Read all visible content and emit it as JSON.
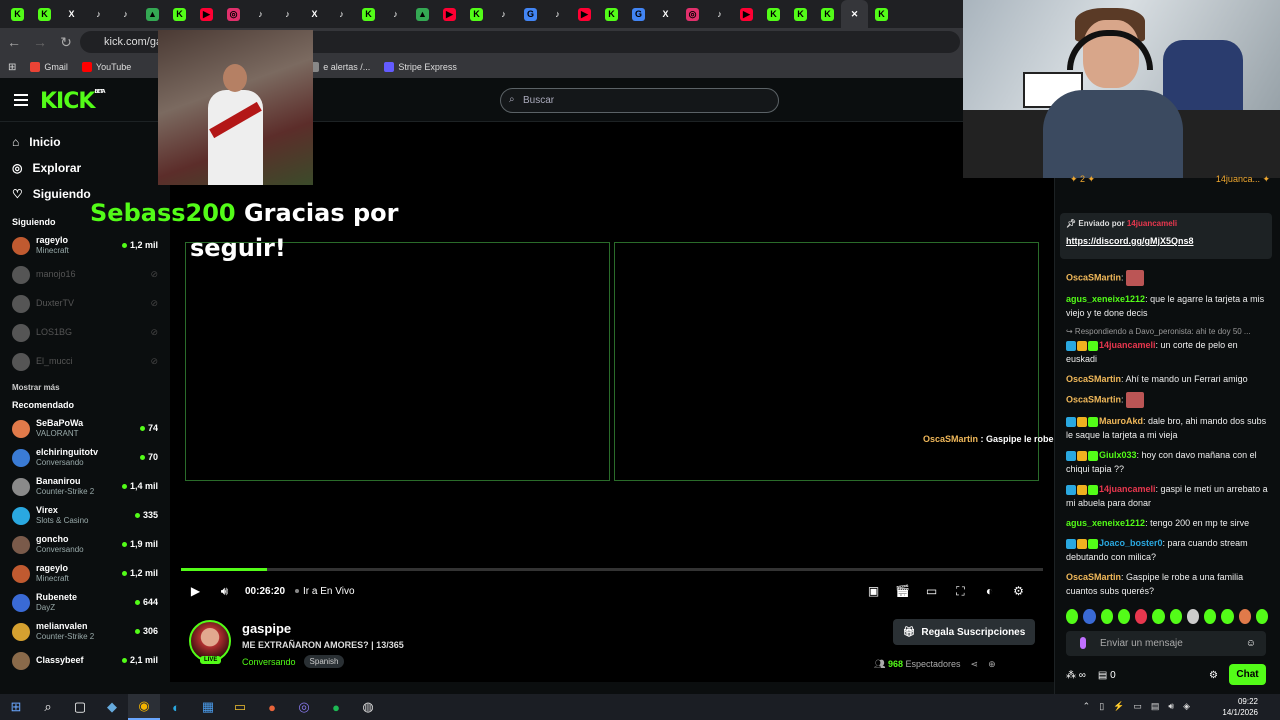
{
  "browser": {
    "tab_icons": [
      "K",
      "K",
      "X",
      "♪",
      "♪",
      "▲",
      "K",
      "▶",
      "◎",
      "♪",
      "♪",
      "X",
      "♪",
      "K",
      "♪",
      "▲",
      "▶",
      "K",
      "♪",
      "G",
      "♪",
      "▶",
      "K",
      "G",
      "X",
      "◎",
      "♪",
      "▶",
      "K",
      "K",
      "K",
      "✕",
      "K"
    ],
    "url": "kick.com/gas",
    "bookmarks": [
      {
        "label": "Gmail",
        "color": "#ea4335"
      },
      {
        "label": "YouTube",
        "color": "#ff0000"
      },
      {
        "label": "e alertas /...",
        "color": "#888888"
      },
      {
        "label": "Stripe Express",
        "color": "#635bff"
      }
    ]
  },
  "header": {
    "logo": "KICK",
    "logo_badge": "BETA",
    "search_placeholder": "Buscar"
  },
  "sidebar": {
    "nav": [
      {
        "label": "Inicio",
        "icon": "home-icon",
        "glyph": "⌂"
      },
      {
        "label": "Explorar",
        "icon": "compass-icon",
        "glyph": "◎"
      },
      {
        "label": "Siguiendo",
        "icon": "heart-icon",
        "glyph": "♡"
      }
    ],
    "following_title": "Siguiendo",
    "following": [
      {
        "name": "rageylo",
        "category": "Minecraft",
        "viewers": "1,2 mil",
        "live": true,
        "color": "#c05a30"
      },
      {
        "name": "manojo16",
        "category": "",
        "viewers": "",
        "live": false,
        "color": "#555"
      },
      {
        "name": "DuxterTV",
        "category": "",
        "viewers": "",
        "live": false,
        "color": "#555"
      },
      {
        "name": "LOS1BG",
        "category": "",
        "viewers": "",
        "live": false,
        "color": "#555"
      },
      {
        "name": "El_mucci",
        "category": "",
        "viewers": "",
        "live": false,
        "color": "#555"
      }
    ],
    "show_more": "Mostrar más",
    "recommended_title": "Recomendado",
    "recommended": [
      {
        "name": "SeBaPoWa",
        "category": "VALORANT",
        "viewers": "74",
        "color": "#e07a4a"
      },
      {
        "name": "elchiringuitotv",
        "category": "Conversando",
        "viewers": "70",
        "color": "#3a7bd5"
      },
      {
        "name": "Bananirou",
        "category": "Counter-Strike 2",
        "viewers": "1,4 mil",
        "color": "#8a8a8a"
      },
      {
        "name": "Virex",
        "category": "Slots & Casino",
        "viewers": "335",
        "color": "#2aa8e0"
      },
      {
        "name": "goncho",
        "category": "Conversando",
        "viewers": "1,9 mil",
        "color": "#7a5a4a"
      },
      {
        "name": "rageylo",
        "category": "Minecraft",
        "viewers": "1,2 mil",
        "color": "#c05a30"
      },
      {
        "name": "Rubenete",
        "category": "DayZ",
        "viewers": "644",
        "color": "#3a6ad5"
      },
      {
        "name": "melianvalen",
        "category": "Counter-Strike 2",
        "viewers": "306",
        "color": "#d5a030"
      },
      {
        "name": "Classybeef",
        "category": "",
        "viewers": "2,1 mil",
        "color": "#8a6a4a"
      }
    ]
  },
  "stream": {
    "alert_name": "Sebass200",
    "alert_text": " Gracias por",
    "alert_text2": "seguir!",
    "overlay_user": "OscaSMartin",
    "overlay_text": " : Gaspipe le robe a una familia cuantos subs querés?",
    "progress_fraction": 0.1,
    "time": "00:26:20",
    "go_live": "Ir a En Vivo"
  },
  "streamer": {
    "name": "gaspipe",
    "live_badge": "LIVE",
    "title": "ME EXTRAÑARON AMORES? | 13/365",
    "category": "Conversando",
    "tag": "Spanish",
    "gift_button": "Regala Suscripciones",
    "viewers": "968",
    "viewers_label": "Espectadores"
  },
  "chat": {
    "preview_left": "✦ 2 ✦",
    "preview_right": "14juanca... ✦",
    "pinned_by_label": "Enviado por",
    "pinned_user": "14juancameli",
    "pinned_link": "https://discord.gg/gMjX5Qns8",
    "messages": [
      {
        "user": "OscaSMartin",
        "color": "#f0b85a",
        "text": "",
        "emote": true
      },
      {
        "user": "agus_xeneixe1212",
        "color": "#53fc18",
        "text": ": que le agarre la tarjeta a mis viejo y te done decis"
      },
      {
        "reply": "↪ Respondiendo a Davo_peronista: ahi te doy 50 ...",
        "user": "14juancameli",
        "color": "#e8374e",
        "text": ": un corte de pelo en euskadi",
        "badges": true
      },
      {
        "user": "OscaSMartin",
        "color": "#f0b85a",
        "text": ": Ahí te mando un Ferrari amigo"
      },
      {
        "user": "OscaSMartin",
        "color": "#f0b85a",
        "text": "",
        "emote": true
      },
      {
        "user": "MauroAkd",
        "color": "#f0b85a",
        "text": ": dale bro, ahi mando dos subs le saque la tarjeta a mi vieja",
        "badges": true
      },
      {
        "user": "Giulx033",
        "color": "#53fc18",
        "text": ": hoy con davo mañana con el chiqui tapia ??",
        "badges": true
      },
      {
        "user": "14juancameli",
        "color": "#e8374e",
        "text": ": gaspi le metí un arrebato a mi abuela para donar",
        "badges": true
      },
      {
        "user": "agus_xeneixe1212",
        "color": "#53fc18",
        "text": ": tengo 200 en mp te sirve"
      },
      {
        "user": "Joaco_boster0",
        "color": "#2aa8e0",
        "text": ": para cuando stream debutando con milica?",
        "badges": true
      },
      {
        "user": "OscaSMartin",
        "color": "#f0b85a",
        "text": ": Gaspipe le robe a una familia cuantos subs querés?"
      }
    ],
    "input_placeholder": "Enviar un mensaje",
    "points_infinite": "∞",
    "points_count": "0",
    "send_label": "Chat"
  },
  "taskbar": {
    "time": "09:22",
    "date": "14/1/2026"
  }
}
